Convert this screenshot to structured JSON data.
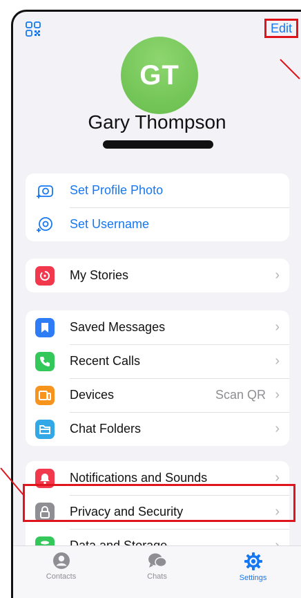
{
  "header": {
    "edit_label": "Edit"
  },
  "profile": {
    "initials": "GT",
    "name": "Gary Thompson"
  },
  "account_group": [
    {
      "label": "Set Profile Photo",
      "icon": "camera-plus-icon"
    },
    {
      "label": "Set Username",
      "icon": "at-plus-icon"
    }
  ],
  "stories_group": [
    {
      "label": "My Stories",
      "icon": "stories-icon",
      "color": "#f2384c"
    }
  ],
  "main_group": [
    {
      "label": "Saved Messages",
      "icon": "bookmark-icon",
      "color": "#2e7cf6"
    },
    {
      "label": "Recent Calls",
      "icon": "phone-icon",
      "color": "#34c759"
    },
    {
      "label": "Devices",
      "icon": "devices-icon",
      "color": "#f7941d",
      "value": "Scan QR"
    },
    {
      "label": "Chat Folders",
      "icon": "folder-icon",
      "color": "#33a8e6"
    }
  ],
  "settings_group": [
    {
      "label": "Notifications and Sounds",
      "icon": "bell-icon",
      "color": "#f2384c"
    },
    {
      "label": "Privacy and Security",
      "icon": "lock-icon",
      "color": "#8e8e93"
    },
    {
      "label": "Data and Storage",
      "icon": "database-icon",
      "color": "#34c759"
    }
  ],
  "tabbar": [
    {
      "label": "Contacts",
      "icon": "person-icon"
    },
    {
      "label": "Chats",
      "icon": "chat-bubbles-icon"
    },
    {
      "label": "Settings",
      "icon": "gear-icon",
      "active": true
    }
  ],
  "colors": {
    "accent": "#1677f2",
    "highlight": "#e0141c",
    "avatar": "#74c85a"
  }
}
